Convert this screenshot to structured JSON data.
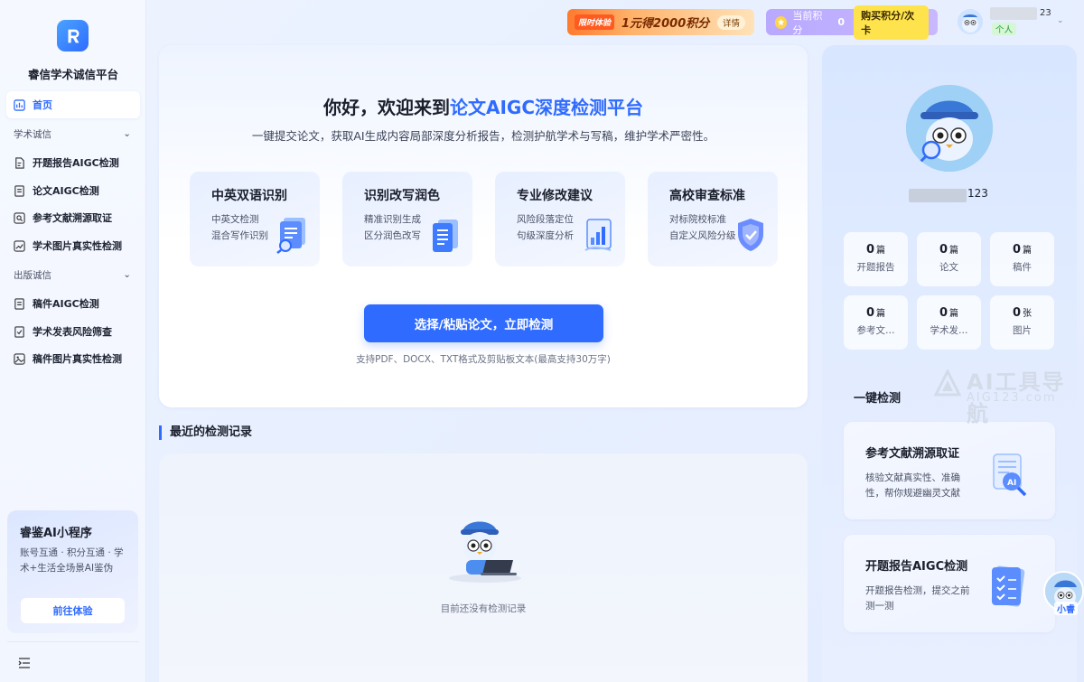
{
  "brand": {
    "name": "睿信学术诚信平台"
  },
  "sidebar": {
    "home_label": "首页",
    "groups": [
      {
        "label": "学术诚信",
        "items": [
          "开题报告AIGC检测",
          "论文AIGC检测",
          "参考文献溯源取证",
          "学术图片真实性检测"
        ]
      },
      {
        "label": "出版诚信",
        "items": [
          "稿件AIGC检测",
          "学术发表风险筛查",
          "稿件图片真实性检测"
        ]
      }
    ],
    "promo": {
      "title": "睿鉴AI小程序",
      "desc": "账号互通 · 积分互通 · 学术+生活全场景AI鉴伪",
      "button": "前往体验"
    }
  },
  "topbar": {
    "promo_tag": "限时体验",
    "promo_text": "1元得2000积分",
    "promo_detail": "详情",
    "points_label": "当前积分",
    "points_value": "0",
    "buy_button": "购买积分/次卡",
    "user_suffix": "23",
    "user_tag": "个人"
  },
  "hero": {
    "title_prefix": "你好，欢迎来到",
    "title_highlight": "论文AIGC深度检测平台",
    "subtitle": "一键提交论文，获取AI生成内容局部深度分析报告，检测护航学术与写稿，维护学术严密性。",
    "features": [
      {
        "title": "中英双语识别",
        "lines": [
          "中英文检测",
          "混合写作识别"
        ]
      },
      {
        "title": "识别改写润色",
        "lines": [
          "精准识别生成",
          "区分润色改写"
        ]
      },
      {
        "title": "专业修改建议",
        "lines": [
          "风险段落定位",
          "句级深度分析"
        ]
      },
      {
        "title": "高校审查标准",
        "lines": [
          "对标院校标准",
          "自定义风险分级"
        ]
      }
    ],
    "cta": "选择/粘贴论文，立即检测",
    "cta_note": "支持PDF、DOCX、TXT格式及剪贴板文本(最高支持30万字)"
  },
  "recent": {
    "title": "最近的检测记录",
    "empty_text": "目前还没有检测记录"
  },
  "profile": {
    "name_suffix": "123",
    "stats": [
      {
        "value": "0",
        "unit": "篇",
        "label": "开题报告"
      },
      {
        "value": "0",
        "unit": "篇",
        "label": "论文"
      },
      {
        "value": "0",
        "unit": "篇",
        "label": "稿件"
      },
      {
        "value": "0",
        "unit": "篇",
        "label": "参考文…"
      },
      {
        "value": "0",
        "unit": "篇",
        "label": "学术发…"
      },
      {
        "value": "0",
        "unit": "张",
        "label": "图片"
      }
    ],
    "oneclick_title": "一键检测",
    "tools": [
      {
        "title": "参考文献溯源取证",
        "desc": "核验文献真实性、准确性，帮你规避幽灵文献"
      },
      {
        "title": "开题报告AIGC检测",
        "desc": "开题报告检测，提交之前测一测"
      }
    ],
    "assistant_label": "小睿"
  },
  "watermark": {
    "text": "AI工具导航",
    "sub": "AIG123.com"
  },
  "colors": {
    "accent": "#2f6bff",
    "promo_orange": "#ff7a2e",
    "points_purple": "#b8a9ff"
  }
}
